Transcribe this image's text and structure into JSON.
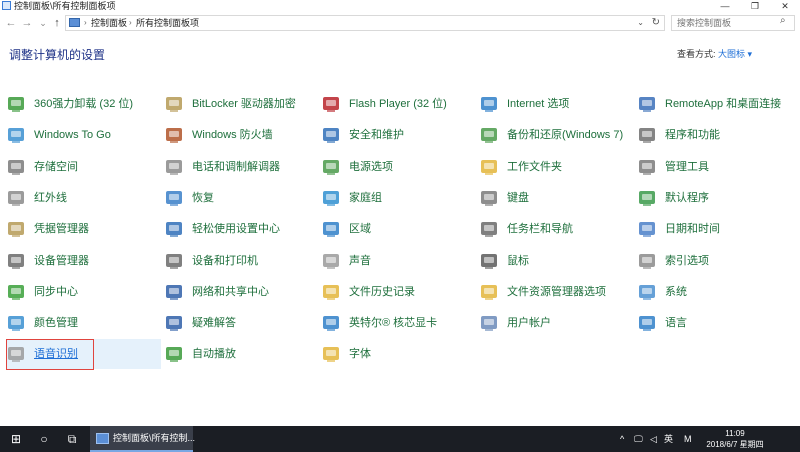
{
  "window": {
    "title": "控制面板\\所有控制面板项"
  },
  "titlebar": {
    "minimize": "—",
    "maximize": "❐",
    "close": "✕"
  },
  "nav": {
    "back": "←",
    "forward": "→",
    "down": "⌄",
    "up": "↑"
  },
  "address": {
    "crumbs": [
      "控制面板",
      "所有控制面板项"
    ],
    "sep": "›",
    "dropdown": "⌄",
    "refresh": "↻"
  },
  "search": {
    "placeholder": "搜索控制面板",
    "icon": "⌕"
  },
  "page": {
    "title": "调整计算机的设置",
    "view_label": "查看方式:",
    "view_value": "大图标 ▾"
  },
  "items": [
    {
      "label": "360强力卸载 (32 位)",
      "icon": "uninstall-icon",
      "color": "#3a9a3a"
    },
    {
      "label": "BitLocker 驱动器加密",
      "icon": "bitlocker-key-icon",
      "color": "#b59a55"
    },
    {
      "label": "Flash Player (32 位)",
      "icon": "flash-icon",
      "color": "#b8232a"
    },
    {
      "label": "Internet 选项",
      "icon": "internet-globe-icon",
      "color": "#2f7fc8"
    },
    {
      "label": "RemoteApp 和桌面连接",
      "icon": "remoteapp-icon",
      "color": "#3a6fb8"
    },
    {
      "label": "Windows To Go",
      "icon": "windows-to-go-icon",
      "color": "#3a8fd0"
    },
    {
      "label": "Windows 防火墙",
      "icon": "firewall-icon",
      "color": "#b0552a"
    },
    {
      "label": "安全和维护",
      "icon": "flag-icon",
      "color": "#2f6fb8"
    },
    {
      "label": "备份和还原(Windows 7)",
      "icon": "backup-icon",
      "color": "#4a9a4a"
    },
    {
      "label": "程序和功能",
      "icon": "programs-icon",
      "color": "#6f6f6f"
    },
    {
      "label": "存储空间",
      "icon": "storage-icon",
      "color": "#7a7a7a"
    },
    {
      "label": "电话和调制解调器",
      "icon": "phone-modem-icon",
      "color": "#8a8a8a"
    },
    {
      "label": "电源选项",
      "icon": "power-icon",
      "color": "#4a9a4a"
    },
    {
      "label": "工作文件夹",
      "icon": "work-folder-icon",
      "color": "#e3b53a"
    },
    {
      "label": "管理工具",
      "icon": "admin-tools-icon",
      "color": "#7a7a7a"
    },
    {
      "label": "红外线",
      "icon": "infrared-icon",
      "color": "#8a8a8a"
    },
    {
      "label": "恢复",
      "icon": "recovery-icon",
      "color": "#3a7fc8"
    },
    {
      "label": "家庭组",
      "icon": "homegroup-icon",
      "color": "#2f8fd0"
    },
    {
      "label": "键盘",
      "icon": "keyboard-icon",
      "color": "#7a7a7a"
    },
    {
      "label": "默认程序",
      "icon": "default-programs-icon",
      "color": "#3a9a4a"
    },
    {
      "label": "凭据管理器",
      "icon": "credential-icon",
      "color": "#b59a55"
    },
    {
      "label": "轻松使用设置中心",
      "icon": "ease-of-access-icon",
      "color": "#2f6fb8"
    },
    {
      "label": "区域",
      "icon": "region-icon",
      "color": "#2f7fc8"
    },
    {
      "label": "任务栏和导航",
      "icon": "taskbar-icon",
      "color": "#6a6a6a"
    },
    {
      "label": "日期和时间",
      "icon": "calendar-icon",
      "color": "#4a7fc8"
    },
    {
      "label": "设备管理器",
      "icon": "device-manager-icon",
      "color": "#6a6a6a"
    },
    {
      "label": "设备和打印机",
      "icon": "printer-icon",
      "color": "#6a6a6a"
    },
    {
      "label": "声音",
      "icon": "speaker-icon",
      "color": "#9a9a9a"
    },
    {
      "label": "鼠标",
      "icon": "mouse-icon",
      "color": "#5a5a5a"
    },
    {
      "label": "索引选项",
      "icon": "indexing-icon",
      "color": "#8a8a8a"
    },
    {
      "label": "同步中心",
      "icon": "sync-icon",
      "color": "#3aa03a"
    },
    {
      "label": "网络和共享中心",
      "icon": "network-icon",
      "color": "#2f5fa8"
    },
    {
      "label": "文件历史记录",
      "icon": "file-history-icon",
      "color": "#e3b53a"
    },
    {
      "label": "文件资源管理器选项",
      "icon": "explorer-options-icon",
      "color": "#e3b53a"
    },
    {
      "label": "系统",
      "icon": "system-icon",
      "color": "#4a8fd0"
    },
    {
      "label": "颜色管理",
      "icon": "color-management-icon",
      "color": "#3a8fd0"
    },
    {
      "label": "疑难解答",
      "icon": "troubleshoot-icon",
      "color": "#2f5fa8"
    },
    {
      "label": "英特尔® 核芯显卡",
      "icon": "intel-graphics-icon",
      "color": "#2f7fc8"
    },
    {
      "label": "用户帐户",
      "icon": "user-accounts-icon",
      "color": "#6a8ab8"
    },
    {
      "label": "语言",
      "icon": "language-icon",
      "color": "#2f7fc8"
    },
    {
      "label": "语音识别",
      "icon": "microphone-icon",
      "color": "#9a9a9a"
    },
    {
      "label": "自动播放",
      "icon": "autoplay-icon",
      "color": "#3a9a3a"
    },
    {
      "label": "字体",
      "icon": "fonts-icon",
      "color": "#e3b53a"
    }
  ],
  "selected_index": 40,
  "taskbar": {
    "start": "⊞",
    "search": "○",
    "taskview": "⧉",
    "app_label": "控制面板\\所有控制...",
    "tray": [
      "^",
      "🖵",
      "◁",
      "英",
      "M"
    ],
    "time": "11:09",
    "date": "2018/6/7 星期四"
  }
}
